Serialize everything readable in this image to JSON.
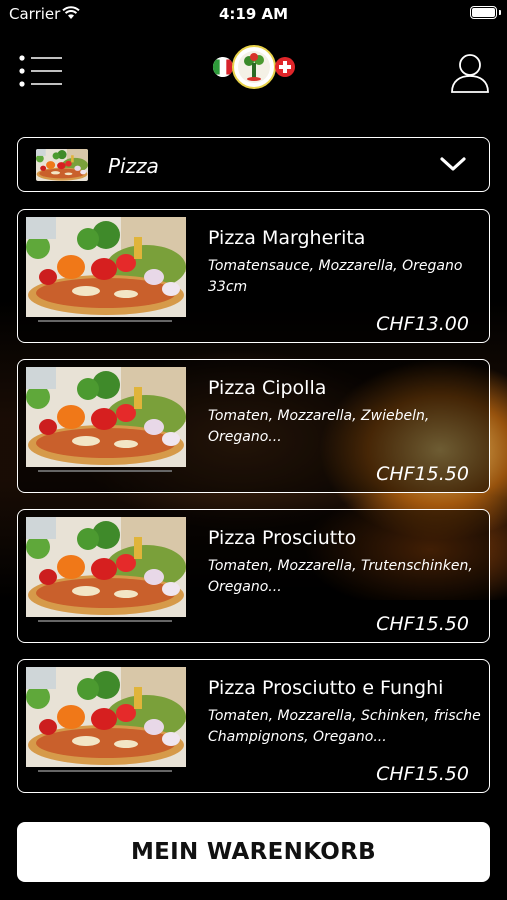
{
  "status_bar": {
    "carrier": "Carrier",
    "time": "4:19 AM"
  },
  "header": {
    "menu_icon": "hamburger-list-icon",
    "logo": "italian-swiss-pizza-logo",
    "user_icon": "user-profile-icon"
  },
  "category": {
    "selected": "Pizza",
    "icon": "chevron-down-icon"
  },
  "products": [
    {
      "name": "Pizza Margherita",
      "description": "Tomatensauce, Mozzarella, Oregano 33cm",
      "price": "CHF13.00"
    },
    {
      "name": "Pizza Cipolla",
      "description": "Tomaten, Mozzarella, Zwiebeln, Oregano...",
      "price": "CHF15.50"
    },
    {
      "name": "Pizza Prosciutto",
      "description": "Tomaten, Mozzarella, Trutenschinken, Oregano...",
      "price": "CHF15.50"
    },
    {
      "name": "Pizza Prosciutto e Funghi",
      "description": "Tomaten, Mozzarella, Schinken, frische Champignons, Oregano...",
      "price": "CHF15.50"
    }
  ],
  "cart_button": {
    "label": "MEIN WARENKORB"
  },
  "colors": {
    "background": "#000000",
    "border": "#ffffff",
    "button_bg": "#ffffff",
    "button_text": "#111111"
  }
}
